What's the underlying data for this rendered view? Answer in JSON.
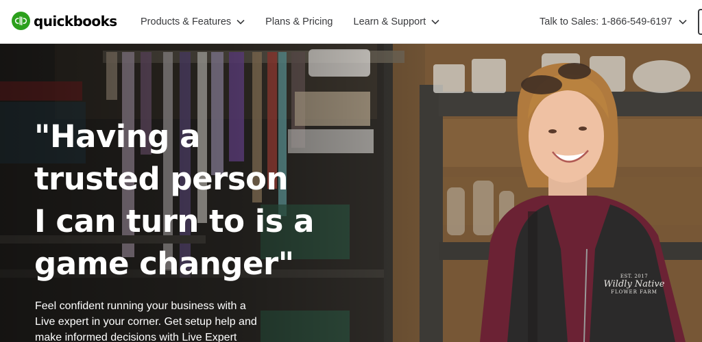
{
  "header": {
    "logo_text": "quickbooks",
    "nav": [
      {
        "label": "Products & Features",
        "has_dropdown": true
      },
      {
        "label": "Plans & Pricing",
        "has_dropdown": false
      },
      {
        "label": "Learn & Support",
        "has_dropdown": true
      }
    ],
    "sales_label": "Talk to Sales: 1-866-549-6197"
  },
  "hero": {
    "quote_lines": [
      "\"Having a",
      "trusted person",
      "I can turn to is a",
      "game changer\""
    ],
    "body_lines": [
      "Feel confident running your business with a",
      "Live expert in your corner. Get setup help and",
      "make informed decisions with Live Expert"
    ],
    "vest_logo": {
      "line1": "EST. 2017",
      "line2": "Wildly Native",
      "line3": "FLOWER FARM"
    }
  },
  "colors": {
    "brand_green": "#2ca01c",
    "nav_text": "#393a3d",
    "hero_text": "#ffffff"
  },
  "icons": {
    "logo": "quickbooks-logo-icon",
    "dropdown": "chevron-down-icon"
  }
}
